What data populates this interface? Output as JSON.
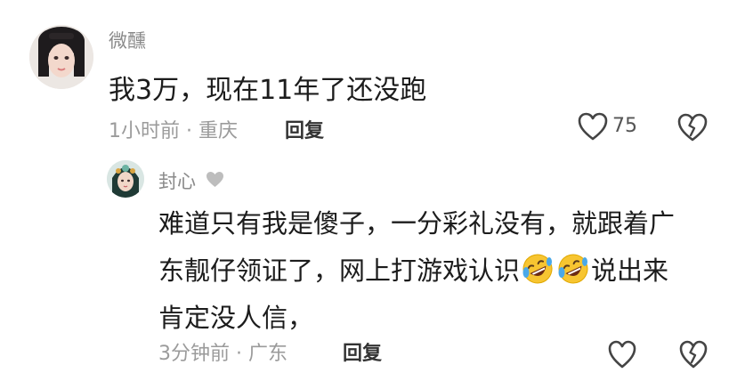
{
  "comments": [
    {
      "username": "微醺",
      "text": "我3万，现在11年了还没跑",
      "time": "1小时前",
      "separator": "·",
      "location": "重庆",
      "reply_label": "回复",
      "like_count": "75",
      "icons": {
        "like": "heart-outline-icon",
        "dislike": "broken-heart-icon"
      }
    },
    {
      "username": "封心",
      "lines": [
        "难道只有我是傻子，一分彩礼没有，就跟着广",
        "东靓仔领证了，网上打游戏认识",
        "说出来",
        "肯定没人信，"
      ],
      "time": "3分钟前",
      "separator": "·",
      "location": "广东",
      "reply_label": "回复",
      "icons": {
        "badge": "gray-heart-icon",
        "emoji": "rolling-on-floor-laughing-emoji"
      }
    }
  ],
  "colors": {
    "background": "#ffffff",
    "primary_text": "#1c1c1c",
    "secondary_text": "#9b9b9b",
    "username": "#8a8a8a",
    "emoji_yellow": "#f7c531",
    "tear_blue": "#4aa8e8"
  }
}
